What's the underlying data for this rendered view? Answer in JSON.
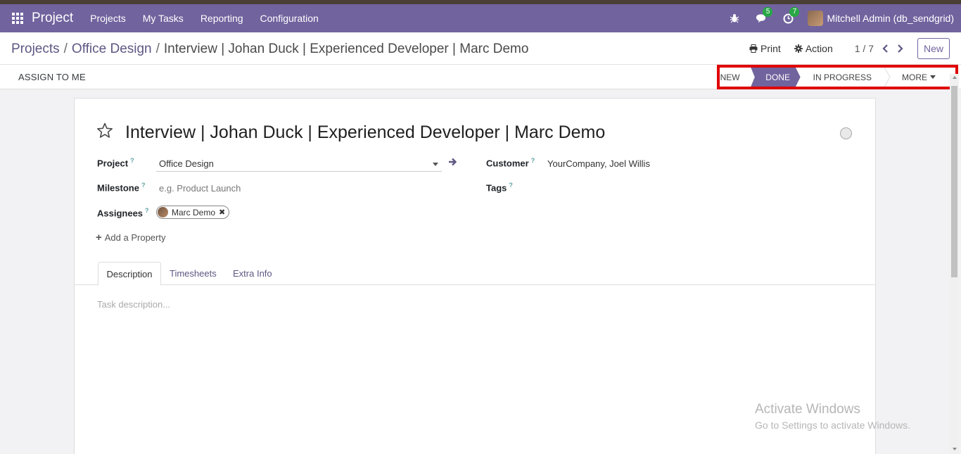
{
  "navbar": {
    "brand": "Project",
    "menu": [
      "Projects",
      "My Tasks",
      "Reporting",
      "Configuration"
    ],
    "messages_count": "5",
    "activities_count": "7",
    "user": "Mitchell Admin (db_sendgrid)",
    "bg_color": "#71639e"
  },
  "breadcrumb": {
    "items": [
      "Projects",
      "Office Design",
      "Interview | Johan Duck | Experienced Developer | Marc Demo"
    ]
  },
  "control": {
    "print_label": "Print",
    "action_label": "Action",
    "pager": "1 / 7",
    "new_label": "New"
  },
  "statusbar": {
    "assign_label": "ASSIGN TO ME",
    "stages": [
      "NEW",
      "DONE",
      "IN PROGRESS"
    ],
    "active_stage": "DONE",
    "more_label": "MORE"
  },
  "task": {
    "title": "Interview | Johan Duck | Experienced Developer | Marc Demo",
    "fields": {
      "project_label": "Project",
      "project_value": "Office Design",
      "milestone_label": "Milestone",
      "milestone_placeholder": "e.g. Product Launch",
      "assignees_label": "Assignees",
      "assignee": "Marc Demo",
      "customer_label": "Customer",
      "customer_value": "YourCompany, Joel Willis",
      "tags_label": "Tags",
      "help_mark": "?"
    },
    "add_property": "Add a Property",
    "tabs": [
      "Description",
      "Timesheets",
      "Extra Info"
    ],
    "description_placeholder": "Task description..."
  },
  "watermark": {
    "title": "Activate Windows",
    "subtitle": "Go to Settings to activate Windows."
  }
}
